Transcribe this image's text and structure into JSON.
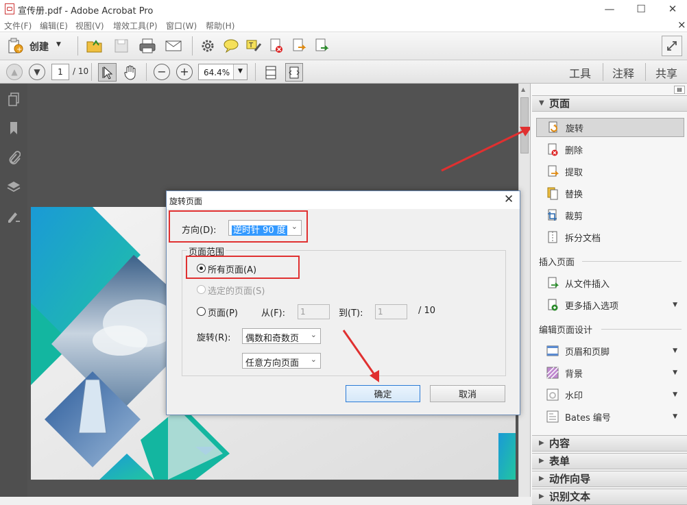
{
  "window": {
    "title": "宣传册.pdf - Adobe Acrobat Pro",
    "minimize": "—",
    "maximize": "☐",
    "close": "✕"
  },
  "menu": [
    {
      "label": "文件(F)"
    },
    {
      "label": "编辑(E)"
    },
    {
      "label": "视图(V)"
    },
    {
      "label": "增效工具(P)"
    },
    {
      "label": "窗口(W)"
    },
    {
      "label": "帮助(H)"
    }
  ],
  "menu_close": "×",
  "toolbar": {
    "create_label": "创建"
  },
  "nav": {
    "page_value": "1",
    "page_total": "/ 10",
    "zoom_value": "64.4%"
  },
  "panel_tabs": {
    "tools": "工具",
    "comment": "注释",
    "share": "共享"
  },
  "right_panel": {
    "pages_header": "页面",
    "pages_items": [
      {
        "label": "旋转",
        "icon": "rotate-page-icon"
      },
      {
        "label": "删除",
        "icon": "delete-page-icon"
      },
      {
        "label": "提取",
        "icon": "extract-page-icon"
      },
      {
        "label": "替换",
        "icon": "replace-page-icon"
      },
      {
        "label": "裁剪",
        "icon": "crop-page-icon"
      },
      {
        "label": "拆分文档",
        "icon": "split-doc-icon"
      }
    ],
    "insert_header": "插入页面",
    "insert_items": [
      {
        "label": "从文件插入"
      },
      {
        "label": "更多插入选项"
      }
    ],
    "design_header": "编辑页面设计",
    "design_items": [
      {
        "label": "页眉和页脚"
      },
      {
        "label": "背景"
      },
      {
        "label": "水印"
      },
      {
        "label": "Bates 编号"
      }
    ],
    "collapsed": [
      "内容",
      "表单",
      "动作向导",
      "识别文本"
    ]
  },
  "dialog": {
    "title": "旋转页面",
    "direction_label": "方向(D):",
    "direction_value": "逆时针 90 度",
    "range_group": "页面范围",
    "opt_all": "所有页面(A)",
    "opt_selected": "选定的页面(S)",
    "opt_pages": "页面(P)",
    "from_label": "从(F):",
    "from_value": "1",
    "to_label": "到(T):",
    "to_value": "1",
    "total": "/ 10",
    "rotate_label": "旋转(R):",
    "rotate_value1": "偶数和奇数页",
    "rotate_value2": "任意方向页面",
    "ok": "确定",
    "cancel": "取消"
  },
  "colors": {
    "highlight_red": "#e03030",
    "selection_blue": "#3399ff",
    "teal": "#22b5a8",
    "blue": "#1a7fd6"
  }
}
